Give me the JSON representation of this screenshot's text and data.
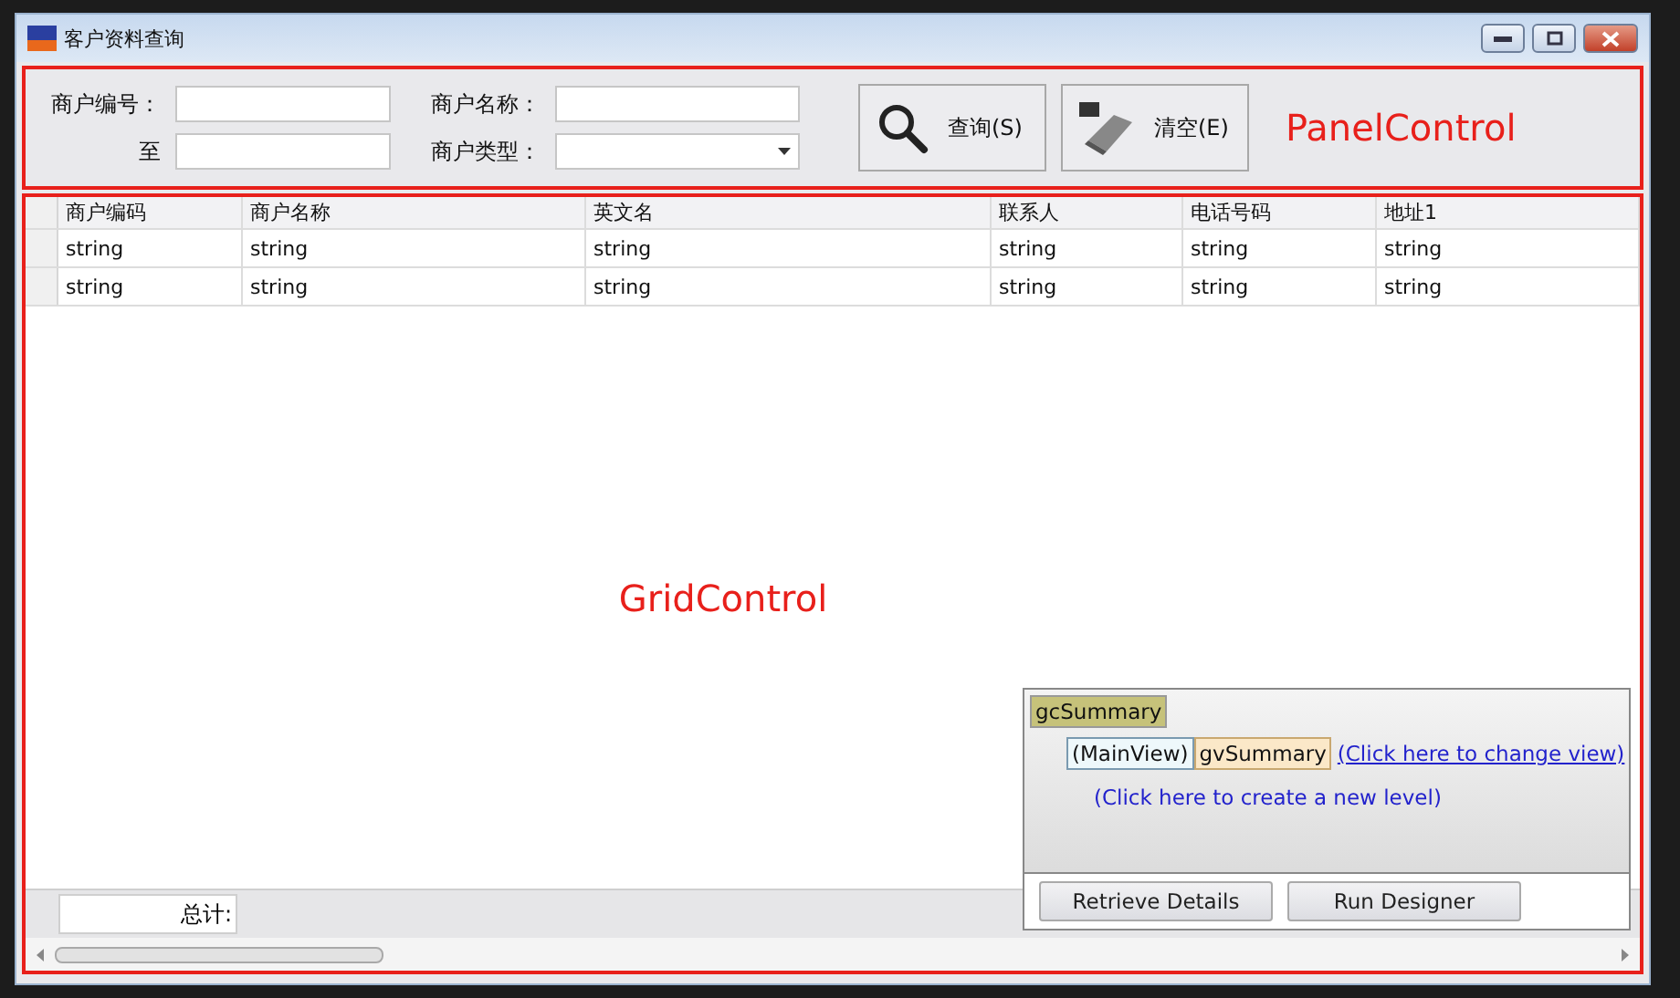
{
  "window": {
    "title": "客户资料查询"
  },
  "panel": {
    "fields": [
      {
        "label": "商户编号：",
        "kind": "text"
      },
      {
        "label": "商户名称：",
        "kind": "text"
      },
      {
        "label": "至",
        "kind": "text"
      },
      {
        "label": "商户类型：",
        "kind": "dropdown"
      }
    ],
    "buttons": [
      {
        "label": "查询(S)",
        "kind": "search"
      },
      {
        "label": "清空(E)",
        "kind": "clear"
      }
    ],
    "annotation": "PanelControl"
  },
  "grid": {
    "columns": [
      "商户编码",
      "商户名称",
      "英文名",
      "联系人",
      "电话号码",
      "地址1"
    ],
    "rows": [
      [
        "string",
        "string",
        "string",
        "string",
        "string",
        "string"
      ],
      [
        "string",
        "string",
        "string",
        "string",
        "string",
        "string"
      ]
    ],
    "annotation": "GridControl",
    "footer": {
      "total_label": "总计:"
    }
  },
  "designer": {
    "title": "gcSummary",
    "view_type": "(MainView)",
    "view_name": "gvSummary",
    "change_view_link": "(Click here to change view)",
    "new_level_link": "(Click here to create a new level)",
    "buttons": [
      "Retrieve Details",
      "Run Designer"
    ]
  }
}
